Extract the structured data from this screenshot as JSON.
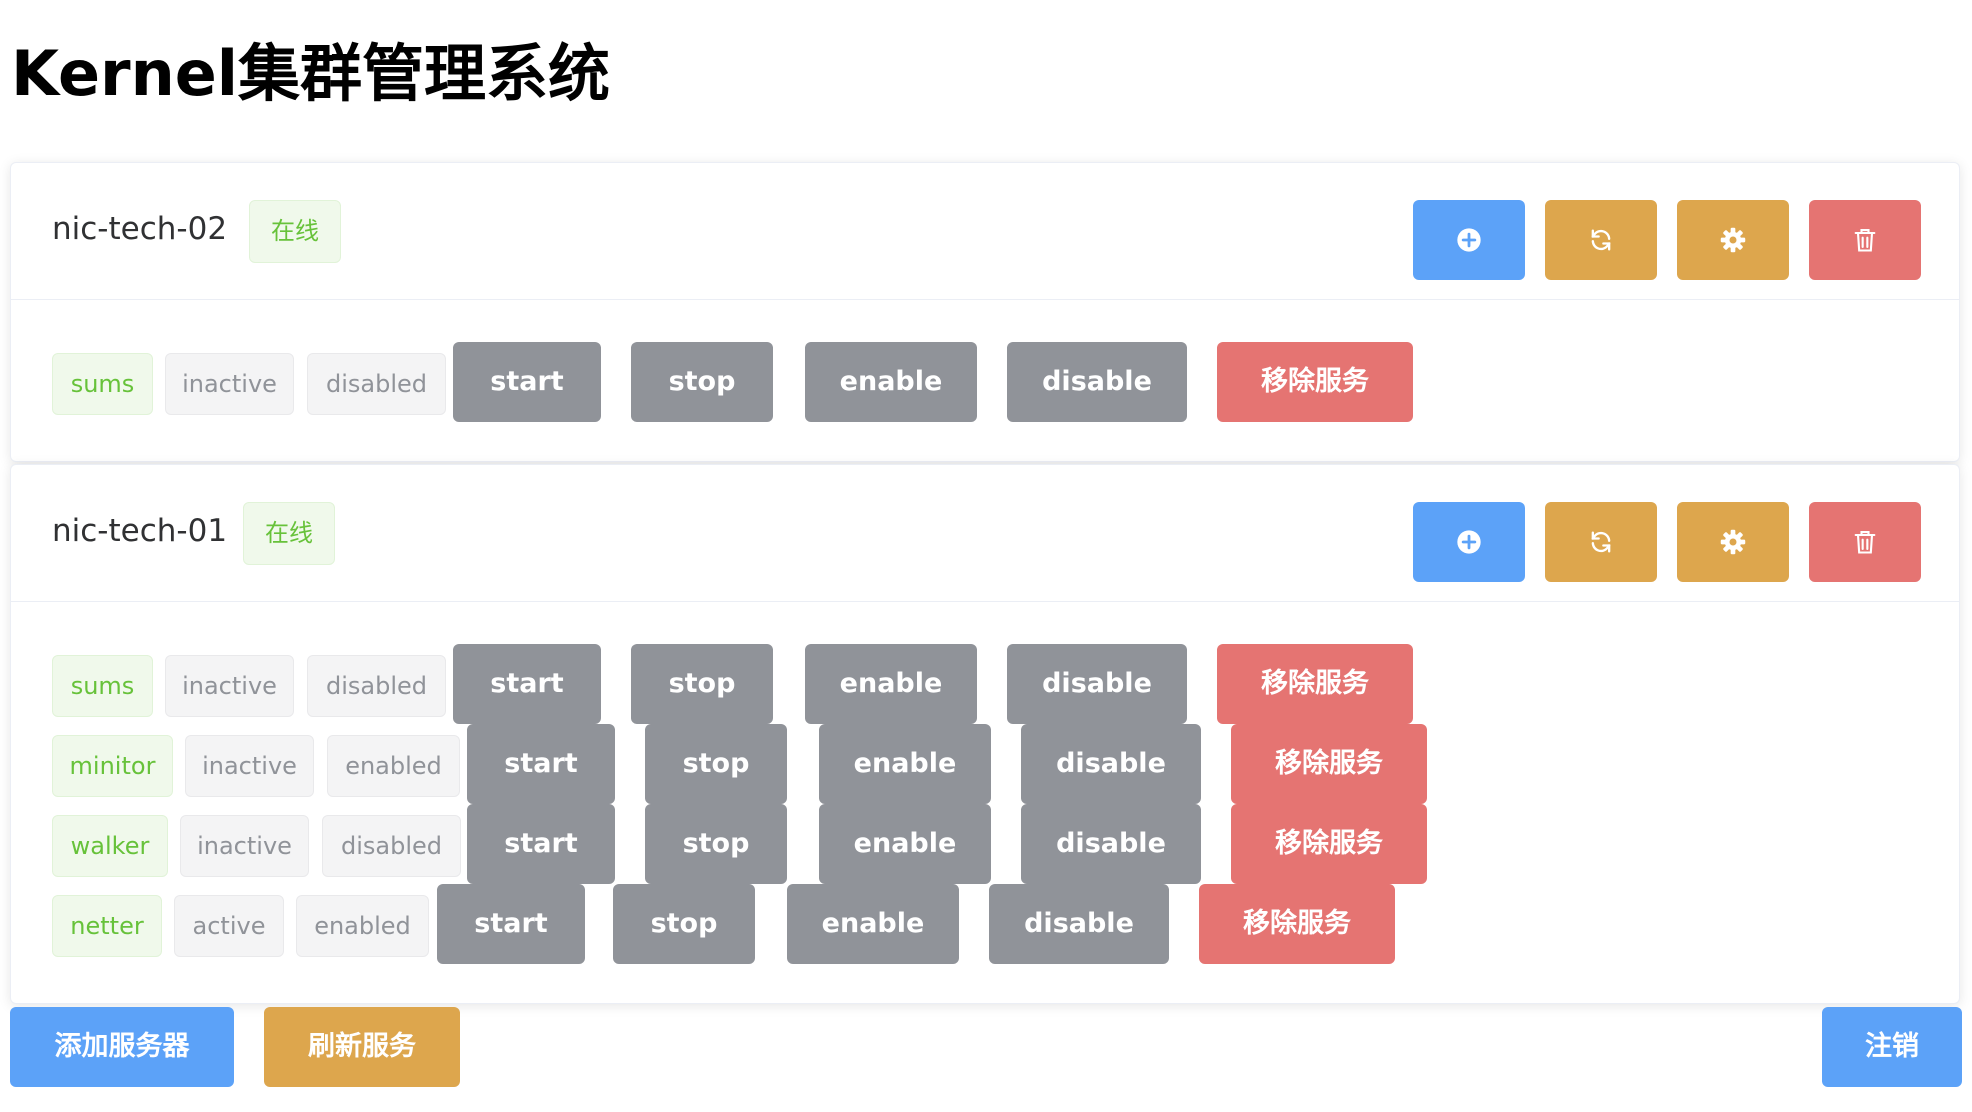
{
  "title": "Kernel集群管理系统",
  "servers": [
    {
      "name": "nic-tech-02",
      "status": "在线",
      "services": [
        {
          "name": "sums",
          "state": "inactive",
          "enabled": "disabled"
        }
      ]
    },
    {
      "name": "nic-tech-01",
      "status": "在线",
      "services": [
        {
          "name": "sums",
          "state": "inactive",
          "enabled": "disabled"
        },
        {
          "name": "minitor",
          "state": "inactive",
          "enabled": "enabled"
        },
        {
          "name": "walker",
          "state": "inactive",
          "enabled": "disabled"
        },
        {
          "name": "netter",
          "state": "active",
          "enabled": "enabled"
        }
      ]
    }
  ],
  "actions": {
    "start": "start",
    "stop": "stop",
    "enable": "enable",
    "disable": "disable",
    "remove": "移除服务"
  },
  "header_icons": [
    "plus-circle-icon",
    "refresh-icon",
    "gear-icon",
    "trash-icon"
  ],
  "footer": {
    "add_server": "添加服务器",
    "refresh_services": "刷新服务",
    "logout": "注销"
  },
  "colors": {
    "primary": "#5ca2f8",
    "warning": "#dda64d",
    "danger": "#e57472",
    "info": "#909399",
    "success": "#67c23a"
  }
}
